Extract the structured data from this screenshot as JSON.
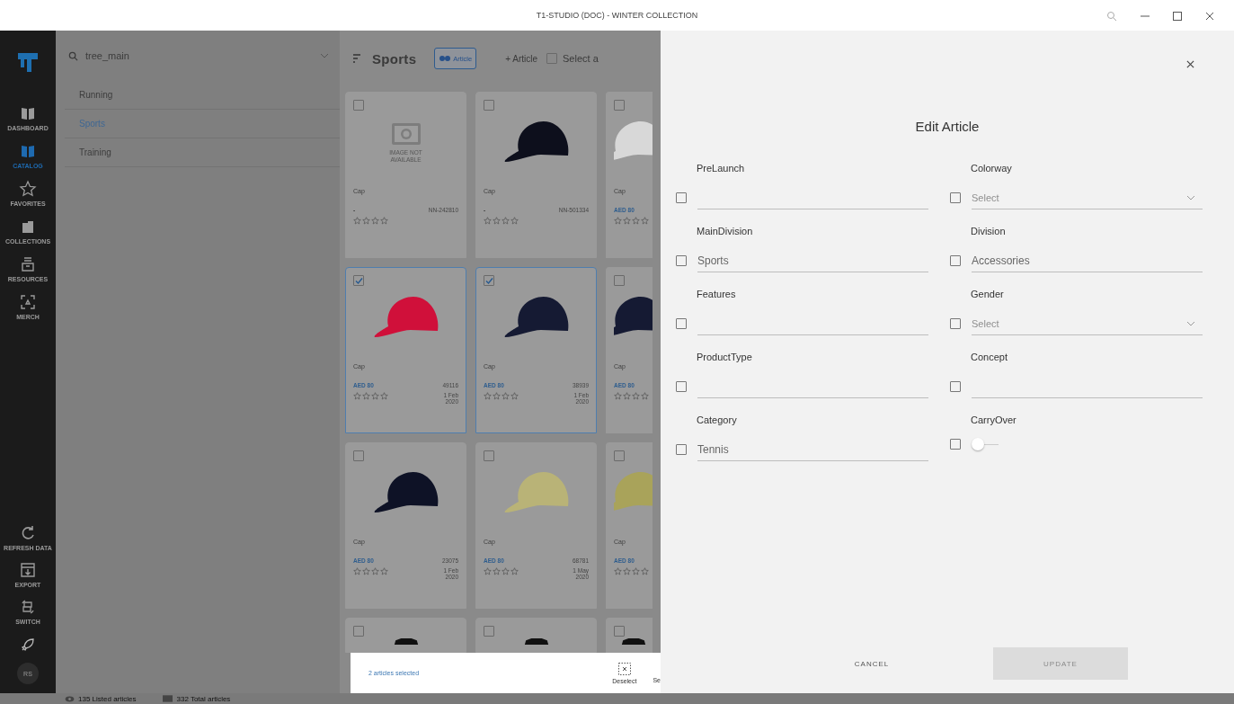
{
  "window": {
    "title": "T1-STUDIO (DOC) - WINTER COLLECTION"
  },
  "nav": {
    "items": [
      {
        "label": "DASHBOARD",
        "kind": "book",
        "selected": false
      },
      {
        "label": "CATALOG",
        "kind": "book",
        "selected": true
      },
      {
        "label": "FAVORITES",
        "kind": "star",
        "selected": false
      },
      {
        "label": "COLLECTIONS",
        "kind": "folder",
        "selected": false
      },
      {
        "label": "RESOURCES",
        "kind": "drawer",
        "selected": false
      },
      {
        "label": "MERCH",
        "kind": "scan",
        "selected": false
      }
    ],
    "bottom_items": [
      {
        "label": "REFRESH DATA",
        "kind": "refresh"
      },
      {
        "label": "EXPORT",
        "kind": "export"
      },
      {
        "label": "SWITCH",
        "kind": "switch"
      }
    ],
    "avatar": "RS"
  },
  "tree": {
    "search_value": "tree_main",
    "items": [
      {
        "label": "Running",
        "selected": false
      },
      {
        "label": "Sports",
        "selected": true
      },
      {
        "label": "Training",
        "selected": false
      }
    ]
  },
  "toolbar": {
    "title": "Sports",
    "view_toggle": "Article",
    "add_button": "+ Article",
    "select_all": "Select a",
    "select_all_checked": false
  },
  "cards": [
    {
      "kind": "none",
      "image_text": "IMAGE NOT AVAILABLE",
      "checked": false,
      "name": "Cap",
      "price": "-",
      "code": "NN-242810",
      "stars": 0
    },
    {
      "kind": "cap",
      "color": "#0d0f1c",
      "checked": false,
      "name": "Cap",
      "price": "-",
      "code": "NN-501334",
      "stars": 0
    },
    {
      "kind": "cap",
      "color": "#d8d8d8",
      "checked": false,
      "name": "Cap",
      "price": "AED 80",
      "stars": 0
    },
    {
      "kind": "cap",
      "color": "#d0103a",
      "checked": true,
      "name": "Cap",
      "price": "AED 80",
      "code": "49116",
      "date": "1 Feb 2020",
      "stars": 0
    },
    {
      "kind": "cap",
      "color": "#151a33",
      "checked": true,
      "name": "Cap",
      "price": "AED 80",
      "code": "38939",
      "date": "1 Feb 2020",
      "stars": 0
    },
    {
      "kind": "cap",
      "color": "#151a33",
      "checked": false,
      "name": "Cap",
      "price": "AED 80",
      "stars": 0
    },
    {
      "kind": "cap",
      "color": "#0e1226",
      "checked": false,
      "name": "Cap",
      "price": "AED 80",
      "code": "23075",
      "date": "1 Feb 2020",
      "stars": 0
    },
    {
      "kind": "cap",
      "color": "#b9b377",
      "checked": false,
      "name": "Cap",
      "price": "AED 80",
      "code": "68781",
      "date": "1 May 2020",
      "stars": 0
    },
    {
      "kind": "cap",
      "color": "#a9a35a",
      "checked": false,
      "name": "Cap",
      "price": "AED 80",
      "stars": 0
    },
    {
      "kind": "shirt",
      "color": "#111111",
      "checked": false
    },
    {
      "kind": "shirt",
      "color": "#111111",
      "checked": false
    },
    {
      "kind": "shirt",
      "color": "#111111",
      "checked": false
    }
  ],
  "selection_bar": {
    "text": "2 articles selected",
    "deselect": "Deselect",
    "next_cut": "Se"
  },
  "status_bar": {
    "listed": "135 Listed articles",
    "total": "332 Total articles"
  },
  "dialog": {
    "title": "Edit Article",
    "fields": [
      {
        "label": "PreLaunch",
        "kind": "text",
        "checked": false
      },
      {
        "label": "Colorway",
        "kind": "select",
        "checked": false,
        "placeholder": "Select"
      },
      {
        "label": "MainDivision",
        "kind": "text",
        "checked": false,
        "value": "Sports"
      },
      {
        "label": "Division",
        "kind": "text",
        "checked": false,
        "value": "Accessories"
      },
      {
        "label": "Features",
        "kind": "text",
        "checked": false
      },
      {
        "label": "Gender",
        "kind": "select",
        "checked": false,
        "placeholder": "Select"
      },
      {
        "label": "ProductType",
        "kind": "text",
        "checked": false
      },
      {
        "label": "Concept",
        "kind": "text",
        "checked": false
      },
      {
        "label": "Category",
        "kind": "text",
        "checked": false,
        "value": "Tennis"
      },
      {
        "label": "CarryOver",
        "kind": "toggle",
        "checked": false,
        "on": false
      }
    ],
    "cancel": "CANCEL",
    "update": {
      "label": "UPDATE",
      "disabled": true
    }
  }
}
